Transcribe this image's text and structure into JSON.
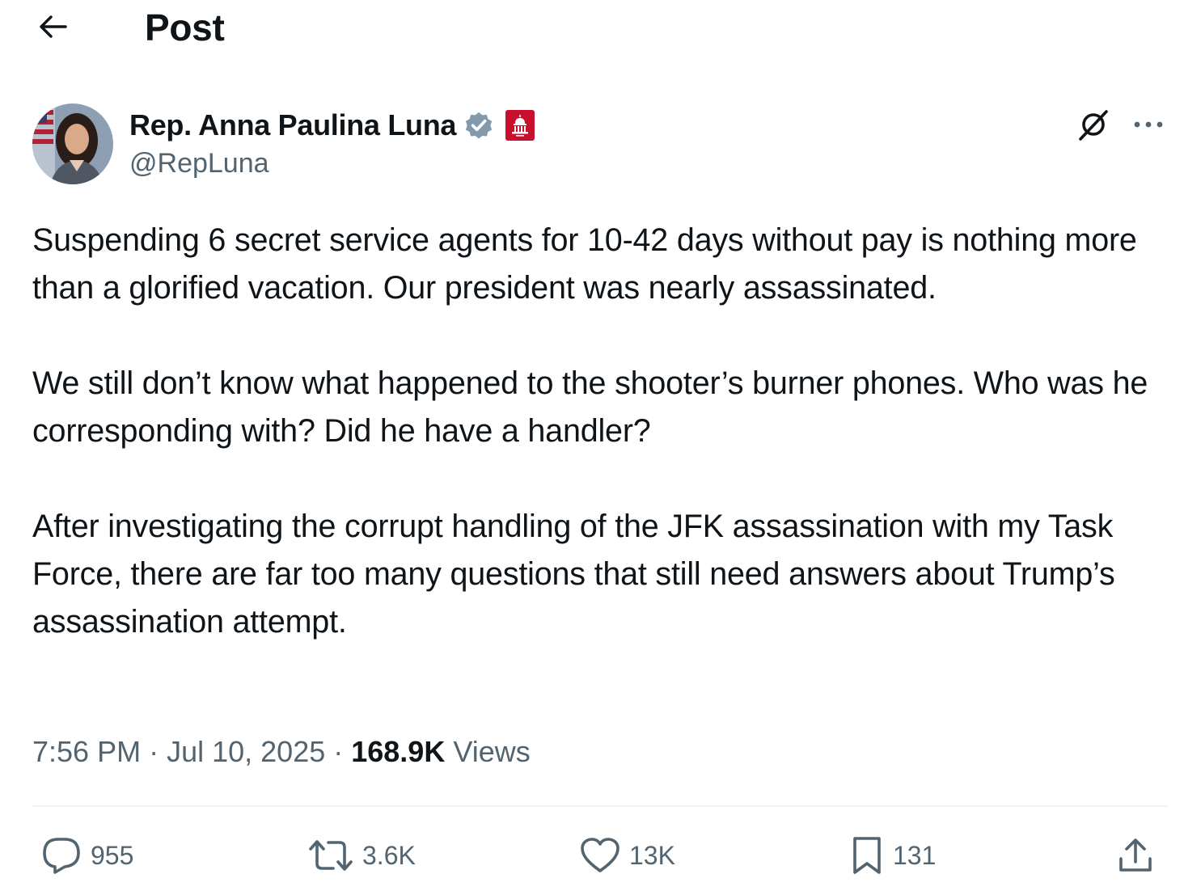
{
  "header": {
    "back_icon": "arrow-left-icon",
    "title": "Post"
  },
  "author": {
    "display_name": "Rep. Anna Paulina Luna",
    "handle": "@RepLuna",
    "verified_icon": "verified-badge-icon",
    "affiliation_icon": "us-capitol-badge-icon",
    "affiliation_color": "#c8102e",
    "verified_color": "#829aab"
  },
  "top_actions": {
    "grok_icon": "grok-icon",
    "more_icon": "more-dots-icon"
  },
  "tweet": {
    "paragraphs": [
      "Suspending 6 secret service agents for 10-42 days without pay is nothing more than a glorified vacation. Our president was nearly assassinated.",
      "We still don’t know what happened to the shooter’s burner phones. Who was he corresponding with? Did he have a handler?",
      "After investigating the corrupt handling of the JFK assassination with my Task Force, there are far too many questions that still need answers about Trump’s assassination attempt."
    ],
    "time": "7:56 PM",
    "separator": " · ",
    "date": "Jul 10, 2025",
    "views_count": "168.9K",
    "views_label": " Views"
  },
  "engagement": {
    "replies": "955",
    "reposts": "3.6K",
    "likes": "13K",
    "bookmarks": "131",
    "reply_icon": "reply-bubble-icon",
    "repost_icon": "repost-icon",
    "like_icon": "heart-icon",
    "bookmark_icon": "bookmark-icon",
    "share_icon": "share-icon"
  },
  "colors": {
    "text_primary": "#0f1419",
    "text_secondary": "#536471",
    "divider": "#eff3f4"
  }
}
